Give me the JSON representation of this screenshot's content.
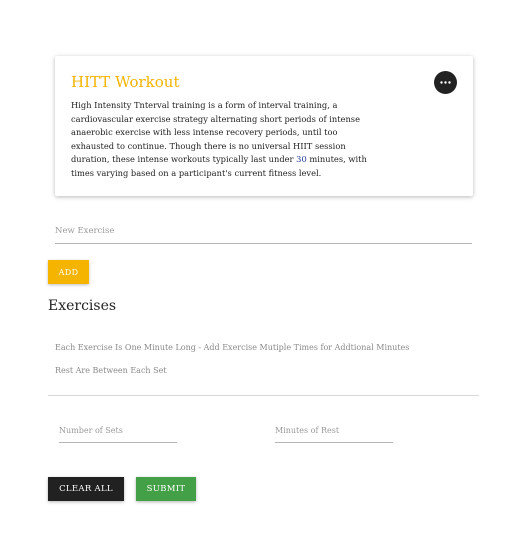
{
  "card": {
    "title": "HITT Workout",
    "menu_icon": "more-horizontal-icon",
    "description": {
      "before": "High Intensity Tnterval training is a form of interval training, a cardiovascular exercise strategy alternating short periods of intense anaerobic exercise with less intense recovery periods, until too exhausted to continue. Though there is no universal HIIT session duration, these intense workouts typically last under ",
      "highlight": "30",
      "after": " minutes, with times varying based on a participant's current fitness level."
    }
  },
  "new_exercise": {
    "placeholder": "New Exercise",
    "value": ""
  },
  "add_button": {
    "label": "ADD"
  },
  "exercises": {
    "title": "Exercises",
    "info_line_1": "Each Exercise Is One Minute Long - Add Exercise Mutiple Times for Addtional Minutes",
    "info_line_2": "Rest Are Between Each Set"
  },
  "sets_field": {
    "placeholder": "Number of Sets",
    "value": ""
  },
  "rest_field": {
    "placeholder": "Minutes of Rest",
    "value": ""
  },
  "clear_button": {
    "label": "CLEAR ALL"
  },
  "submit_button": {
    "label": "SUBMIT"
  },
  "colors": {
    "accent": "#f4b400",
    "dark": "#212121",
    "success": "#43a047",
    "link": "#1f3b9c"
  }
}
